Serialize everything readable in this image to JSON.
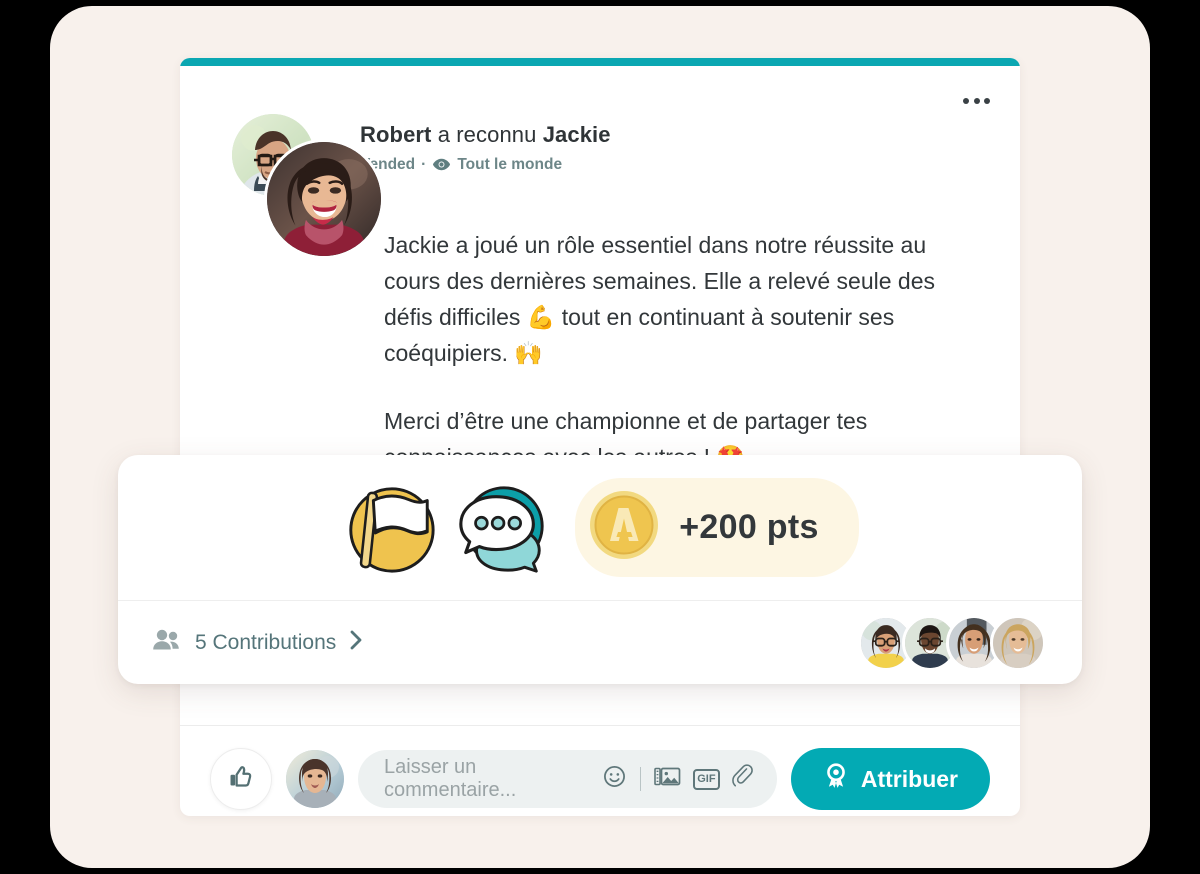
{
  "theme": {
    "page_bg": "#000000",
    "backdrop_bg": "#F8F1EC",
    "card_bg": "#FFFFFF",
    "accent_teal": "#0BA7B2",
    "button_teal": "#03AAB4",
    "points_pill_bg": "#FDF6E3",
    "coin_gold": "#EFC54F",
    "muted_text": "#6D8688",
    "body_text": "#32373A"
  },
  "post": {
    "title_actor": "Robert",
    "title_verb": " a reconnu ",
    "title_target": "Jackie",
    "subtitle_org": "Vended",
    "subtitle_separator": "·",
    "subtitle_visibility": "Tout le monde",
    "more_menu_label": "•••",
    "body_paragraphs": [
      "Jackie a joué un rôle essentiel dans notre réussite au cours des dernières semaines. Elle a relevé seule des défis difficiles 💪 tout en continuant à soutenir ses coéquipiers. 🙌",
      "Merci d’être une championne et de partager tes connaissances avec les autres ! 🤩"
    ],
    "avatars": {
      "giver_name": "Robert",
      "receiver_name": "Jackie"
    }
  },
  "float_card": {
    "badges": [
      {
        "name": "flag-badge",
        "label": "Flag badge"
      },
      {
        "name": "speech-bubble-badge",
        "label": "Speech bubble badge"
      }
    ],
    "points": {
      "coin_icon": "points-coin-icon",
      "text": "+200 pts",
      "value": 200,
      "unit": "pts"
    },
    "contributions": {
      "icon": "people-icon",
      "label": "5 Contributions",
      "count": 5,
      "chevron": "›",
      "contributor_count": 4
    }
  },
  "composer": {
    "like_icon": "thumbs-up-icon",
    "user_avatar": "current-user-avatar",
    "placeholder": "Laisser un commentaire...",
    "tools": [
      {
        "name": "emoji-icon",
        "label": "Emoji"
      },
      {
        "name": "image-icon",
        "label": "Image"
      },
      {
        "name": "gif-icon",
        "label": "GIF"
      },
      {
        "name": "attachment-icon",
        "label": "Attachment"
      }
    ],
    "gif_label": "GIF",
    "award_button": {
      "icon": "award-medal-icon",
      "label": "Attribuer"
    }
  }
}
